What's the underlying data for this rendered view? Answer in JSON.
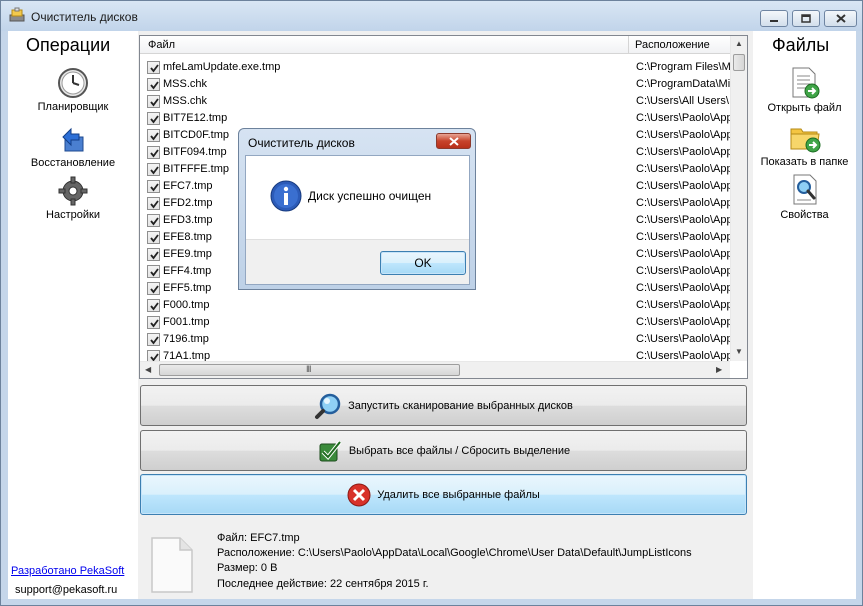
{
  "window": {
    "title": "Очиститель дисков"
  },
  "left_panel": {
    "header": "Операции",
    "items": [
      {
        "label": "Планировщик",
        "icon": "clock-icon"
      },
      {
        "label": "Восстановление",
        "icon": "restore-icon"
      },
      {
        "label": "Настройки",
        "icon": "gear-icon"
      }
    ],
    "credit_link": "Разработано PekaSoft",
    "credit_email": "support@pekasoft.ru"
  },
  "right_panel": {
    "header": "Файлы",
    "items": [
      {
        "label": "Открыть файл",
        "icon": "open-file-icon"
      },
      {
        "label": "Показать в папке",
        "icon": "folder-icon"
      },
      {
        "label": "Свойства",
        "icon": "properties-icon"
      }
    ]
  },
  "file_list": {
    "columns": [
      "Файл",
      "Расположение"
    ],
    "rows": [
      {
        "name": "mfeLamUpdate.exe.tmp",
        "location": "C:\\Program Files\\Mc",
        "checked": true
      },
      {
        "name": "MSS.chk",
        "location": "C:\\ProgramData\\Mi",
        "checked": true
      },
      {
        "name": "MSS.chk",
        "location": "C:\\Users\\All Users\\",
        "checked": true
      },
      {
        "name": "BIT7E12.tmp",
        "location": "C:\\Users\\Paolo\\App",
        "checked": true
      },
      {
        "name": "BITCD0F.tmp",
        "location": "C:\\Users\\Paolo\\App",
        "checked": true
      },
      {
        "name": "BITF094.tmp",
        "location": "C:\\Users\\Paolo\\App",
        "checked": true
      },
      {
        "name": "BITFFFE.tmp",
        "location": "C:\\Users\\Paolo\\App",
        "checked": true
      },
      {
        "name": "EFC7.tmp",
        "location": "C:\\Users\\Paolo\\App",
        "checked": true
      },
      {
        "name": "EFD2.tmp",
        "location": "C:\\Users\\Paolo\\App",
        "checked": true
      },
      {
        "name": "EFD3.tmp",
        "location": "C:\\Users\\Paolo\\App",
        "checked": true
      },
      {
        "name": "EFE8.tmp",
        "location": "C:\\Users\\Paolo\\App",
        "checked": true
      },
      {
        "name": "EFE9.tmp",
        "location": "C:\\Users\\Paolo\\App",
        "checked": true
      },
      {
        "name": "EFF4.tmp",
        "location": "C:\\Users\\Paolo\\App",
        "checked": true
      },
      {
        "name": "EFF5.tmp",
        "location": "C:\\Users\\Paolo\\App",
        "checked": true
      },
      {
        "name": "F000.tmp",
        "location": "C:\\Users\\Paolo\\App",
        "checked": true
      },
      {
        "name": "F001.tmp",
        "location": "C:\\Users\\Paolo\\App",
        "checked": true
      },
      {
        "name": "7196.tmp",
        "location": "C:\\Users\\Paolo\\App",
        "checked": true
      },
      {
        "name": "71A1.tmp",
        "location": "C:\\Users\\Paolo\\App",
        "checked": true
      }
    ],
    "hscroll_grip": "III"
  },
  "actions": {
    "scan": "Запустить сканирование выбранных дисков",
    "select_all": "Выбрать все файлы / Сбросить выделение",
    "delete": "Удалить все выбранные файлы"
  },
  "file_info": {
    "file": "Файл: EFC7.tmp",
    "location": "Расположение: C:\\Users\\Paolo\\AppData\\Local\\Google\\Chrome\\User Data\\Default\\JumpListIcons",
    "size": "Размер: 0 B",
    "last_action": "Последнее действие: 22 сентября 2015 г."
  },
  "dialog": {
    "title": "Очиститель дисков",
    "message": "Диск успешно очищен",
    "ok_label": "OK"
  },
  "colors": {
    "accent": "#3c7fb1",
    "link": "#0000ee"
  }
}
